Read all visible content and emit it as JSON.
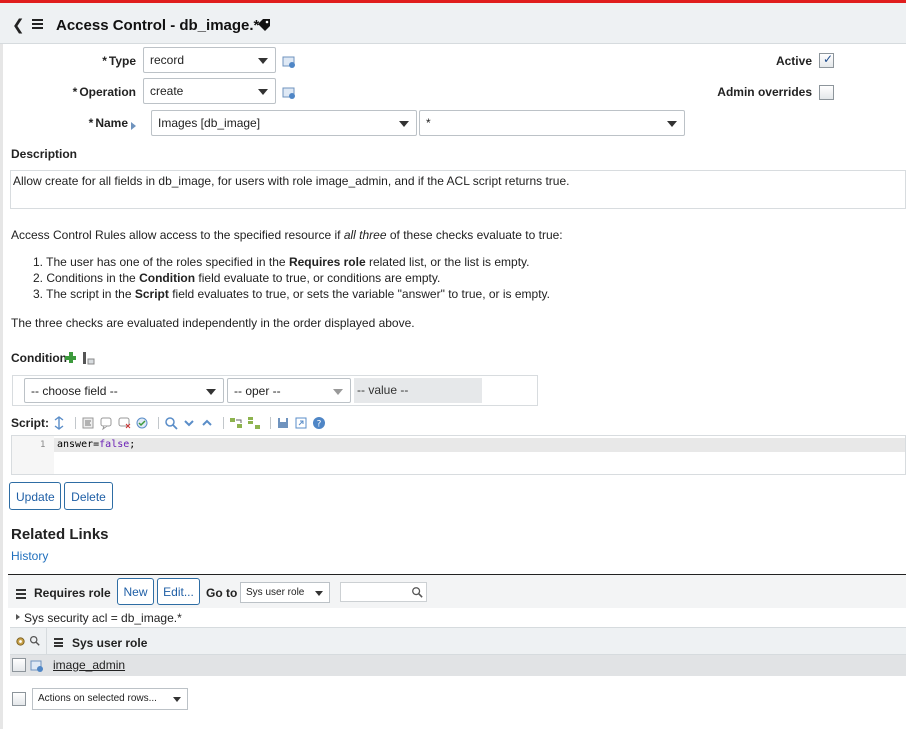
{
  "header": {
    "title": "Access Control - db_image.*",
    "back_icon": "chevron-left-icon",
    "menu_icon": "hamburger-menu-icon",
    "tag_icon": "tag-icon"
  },
  "form": {
    "type_label": "Type",
    "type_value": "record",
    "operation_label": "Operation",
    "operation_value": "create",
    "name_label": "Name",
    "name_table_value": "Images [db_image]",
    "name_field_value": "*",
    "active_label": "Active",
    "active_checked": true,
    "admin_overrides_label": "Admin overrides",
    "admin_overrides_checked": false,
    "required_marker": "*"
  },
  "description": {
    "label": "Description",
    "text": "Allow create for all fields in db_image, for users with role image_admin, and if the ACL script returns true."
  },
  "help": {
    "intro_prefix": "Access Control Rules allow access to the specified resource if ",
    "intro_emph": "all three",
    "intro_suffix": " of these checks evaluate to true:",
    "item1_a": "1. The user has one of the roles specified in the ",
    "item1_b": "Requires role",
    "item1_c": " related list, or the list is empty.",
    "item2_a": "2. Conditions in the ",
    "item2_b": "Condition",
    "item2_c": " field evaluate to true, or conditions are empty.",
    "item3_a": "3. The script in the ",
    "item3_b": "Script",
    "item3_c": " field evaluates to true, or sets the variable \"answer\" to true, or is empty.",
    "footer": "The three checks are evaluated independently in the order displayed above."
  },
  "condition": {
    "label": "Condition",
    "field_placeholder": "-- choose field --",
    "oper_placeholder": "-- oper --",
    "value_placeholder": "-- value --"
  },
  "script": {
    "label": "Script:",
    "line_number": "1",
    "code_prefix": "answer=",
    "code_keyword": "false",
    "code_suffix": ";"
  },
  "buttons": {
    "update": "Update",
    "delete": "Delete"
  },
  "related_links": {
    "title": "Related Links",
    "history": "History"
  },
  "related_list": {
    "title": "Requires role",
    "new_label": "New",
    "edit_label": "Edit...",
    "goto_label": "Go to",
    "goto_value": "Sys user role",
    "filter_text": "Sys security acl = db_image.*",
    "column_header": "Sys user role",
    "rows": [
      {
        "role": "image_admin"
      }
    ],
    "actions_label": "Actions on selected rows..."
  },
  "colors": {
    "accent_red": "#e01d1d",
    "link_blue": "#1f6fbd",
    "header_bg": "#eef1f3"
  }
}
